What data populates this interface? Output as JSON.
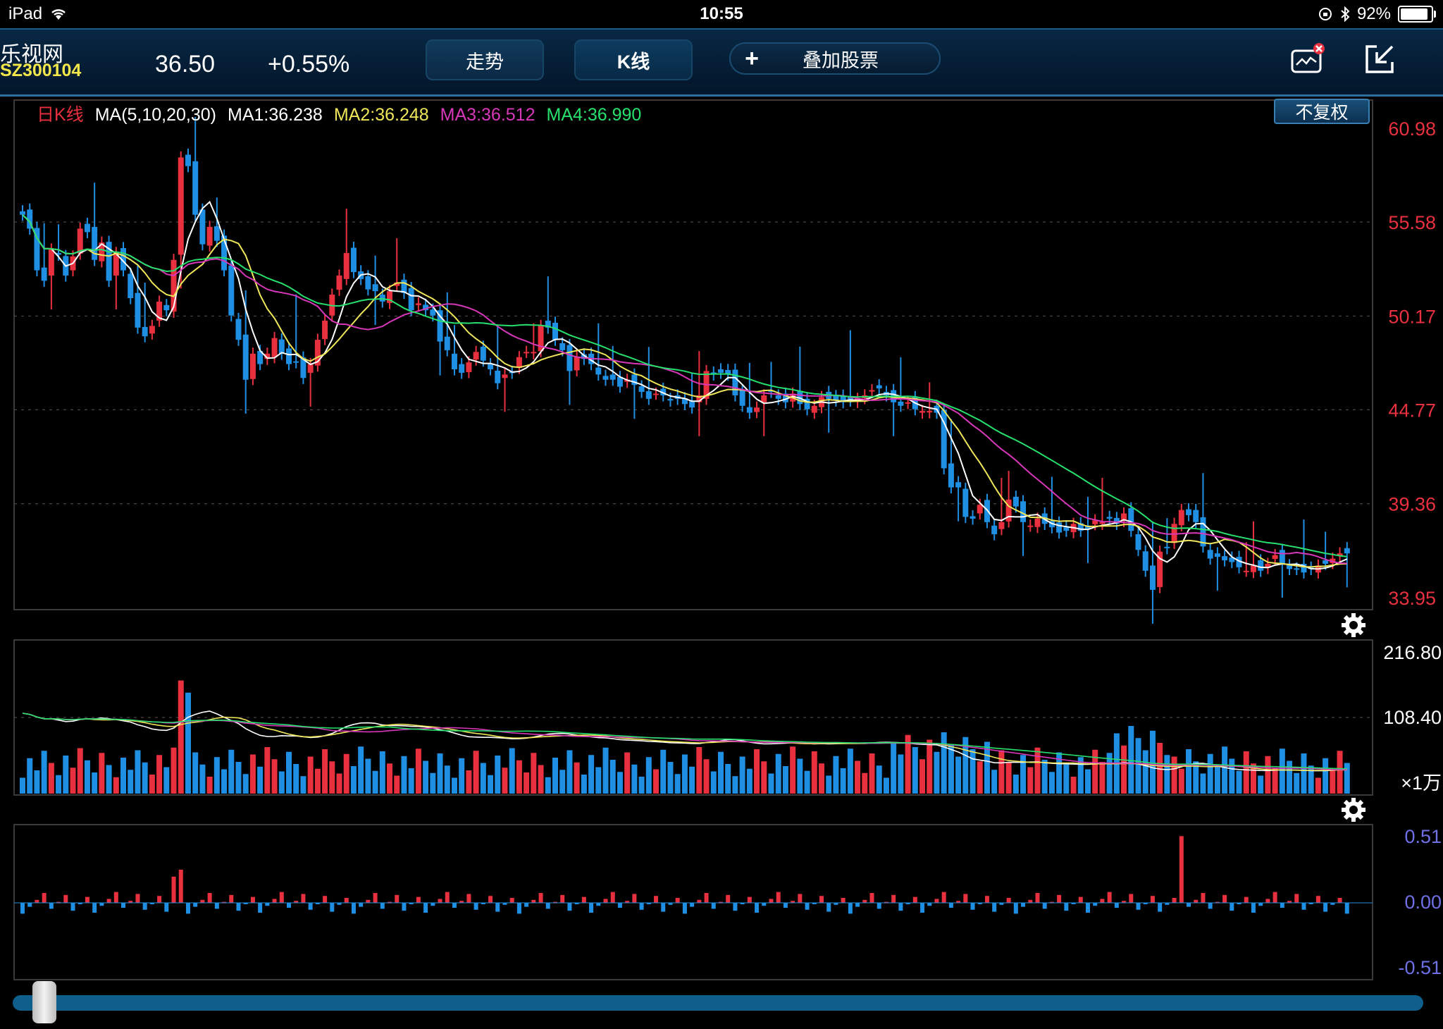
{
  "status_bar": {
    "device": "iPad",
    "time": "10:55",
    "battery": "92%"
  },
  "stock": {
    "name": "乐视网",
    "code": "SZ300104",
    "price": "36.50",
    "change": "+0.55%"
  },
  "tabs": [
    {
      "label": "走势"
    },
    {
      "label": "K线"
    }
  ],
  "overlay_button": {
    "plus": "+",
    "label": "叠加股票"
  },
  "icons": {
    "alert": "chart-alert-icon",
    "exit": "exit-fullscreen-icon"
  },
  "restore_button": {
    "label": "不复权"
  },
  "legend": {
    "period": "日K线",
    "ma": "MA(5,10,20,30)",
    "ma1": "MA1:36.238",
    "ma2": "MA2:36.248",
    "ma3": "MA3:36.512",
    "ma4": "MA4:36.990"
  },
  "colors": {
    "up": "#e8303f",
    "down": "#1f8fe3",
    "ma1": "#ffffff",
    "ma2": "#f0e65a",
    "ma3": "#d737b9",
    "ma4": "#27e06d",
    "bg": "#000000",
    "grid": "#555555"
  },
  "price_axis": {
    "labels": [
      "60.98",
      "55.58",
      "50.17",
      "44.77",
      "39.36",
      "33.95"
    ]
  },
  "volume_axis": {
    "labels": [
      "216.80",
      "108.40"
    ],
    "unit": "×1万"
  },
  "indicator_axis": {
    "labels": [
      "0.51",
      "0.00",
      "-0.51"
    ]
  },
  "chart_data": {
    "type": "candlestick",
    "ylim": [
      33.95,
      60.98
    ],
    "candles_close": [
      56,
      55.2,
      52.8,
      52.2,
      54,
      53.7,
      52.5,
      53.6,
      55.2,
      55,
      53.4,
      54.4,
      52.2,
      53.8,
      52.8,
      51.2,
      49.5,
      49,
      49.6,
      51,
      50.5,
      53.4,
      59.3,
      58.8,
      56,
      54.3,
      55.3,
      54.5,
      52.8,
      50.2,
      48.8,
      46.5,
      48,
      47.4,
      48,
      48.9,
      48,
      47.4,
      47.5,
      46.6,
      47.4,
      48.8,
      49.9,
      51.4,
      52.5,
      53.8,
      52.7,
      52.3,
      51.7,
      51.6,
      51,
      51.6,
      52.1,
      51.5,
      50.5,
      50.9,
      50.5,
      50.2,
      48.7,
      48.2,
      47.1,
      46.9,
      47.5,
      48.1,
      47.6,
      47.1,
      46.3,
      46.8,
      46.9,
      47.8,
      48.1,
      48.1,
      49.6,
      49.5,
      48.8,
      48.2,
      47,
      47.8,
      47.7,
      47.4,
      46.8,
      46.5,
      46.5,
      46.1,
      46.5,
      46.2,
      45.8,
      45.4,
      45.7,
      45.6,
      45.3,
      45.4,
      45.1,
      44.9,
      45.6,
      47,
      46.8,
      46.9,
      46.8,
      45.6,
      45,
      44.6,
      44.9,
      45.6,
      45.8,
      45.4,
      45.2,
      45.7,
      45.1,
      44.8,
      45,
      45.5,
      45.4,
      45.3,
      45.2,
      45.3,
      45.4,
      45.6,
      45.9,
      46,
      45.6,
      45.2,
      45,
      45.2,
      44.8,
      44.7,
      44.7,
      44.6,
      41.4,
      40.3,
      40.3,
      38.6,
      38.5,
      39.3,
      38.3,
      37.6,
      38.3,
      39.6,
      39.2,
      38.3,
      38.1,
      38.5,
      38.2,
      38,
      37.7,
      37.8,
      38.2,
      37.8,
      37.9,
      38.4,
      38.3,
      38.5,
      38.2,
      38.8,
      37.8,
      36.7,
      35.5,
      34.4,
      36.6,
      36.8,
      38.2,
      39,
      38.7,
      38.3,
      36.9,
      36.2,
      36.3,
      36.1,
      36,
      35.7,
      35.5,
      35.8,
      35.5,
      35.9,
      36.4,
      35.9,
      35.6,
      35.6,
      35.4,
      35.6,
      35.8,
      35.9,
      36.2,
      36.5,
      36.5
    ]
  }
}
